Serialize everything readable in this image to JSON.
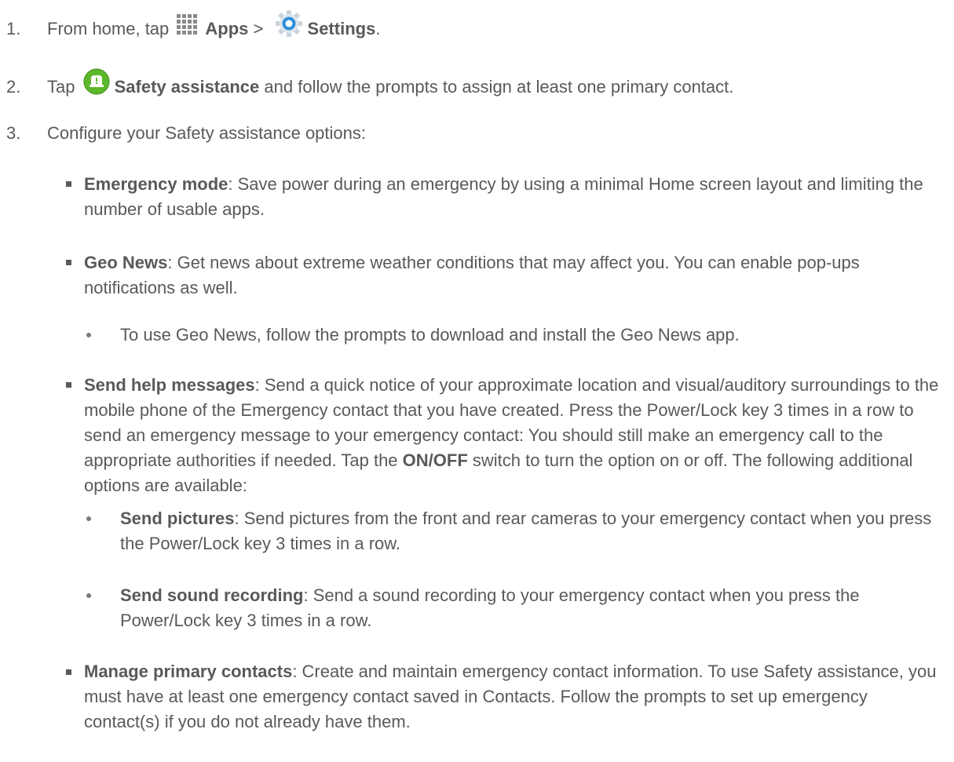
{
  "steps": [
    {
      "number": "1.",
      "text_before": "From home, tap",
      "apps_label": "Apps",
      "separator": ">",
      "settings_label": "Settings",
      "text_after": "."
    },
    {
      "number": "2.",
      "text_before": "Tap",
      "safety_label": "Safety assistance",
      "text_after": "and follow the prompts to assign at least one primary contact."
    },
    {
      "number": "3.",
      "text": "Configure your Safety assistance options:"
    }
  ],
  "options": {
    "emergency_mode": {
      "term": "Emergency mode",
      "desc": ": Save power during an emergency by using a minimal Home screen layout and limiting the number of usable apps."
    },
    "geo_news": {
      "term": "Geo News",
      "desc": ": Get news about extreme weather conditions that may affect you. You can enable pop-ups notifications as well.",
      "sub": "To use Geo News, follow the prompts to download and install the Geo News app."
    },
    "send_help": {
      "term": "Send help messages",
      "desc_before": ": Send a quick notice of your approximate location and visual/auditory surroundings to the mobile phone of the Emergency contact that you have created. Press the Power/Lock key 3 times in a row to send an emergency message to your emergency contact: You should still make an emergency call to the appropriate authorities if needed. Tap the",
      "switch_label": "ON/OFF",
      "desc_after": "switch to turn the option on or off. The following additional options are available:",
      "sub_items": [
        {
          "term": "Send pictures",
          "desc": ": Send pictures from the front and rear cameras to your emergency contact when you press the Power/Lock key 3 times in a row."
        },
        {
          "term": "Send sound recording",
          "desc": ": Send a sound recording to your emergency contact when you press the Power/Lock key 3 times in a row."
        }
      ]
    },
    "manage_contacts": {
      "term": "Manage primary contacts",
      "desc": ": Create and maintain emergency contact information. To use Safety assistance, you must have at least one emergency contact saved in Contacts. Follow the prompts to set up emergency contact(s) if you do not already have them."
    }
  },
  "colors": {
    "text": "#595959",
    "safety_icon": "#5cb82a",
    "settings_icon": "#2b8fd8"
  }
}
